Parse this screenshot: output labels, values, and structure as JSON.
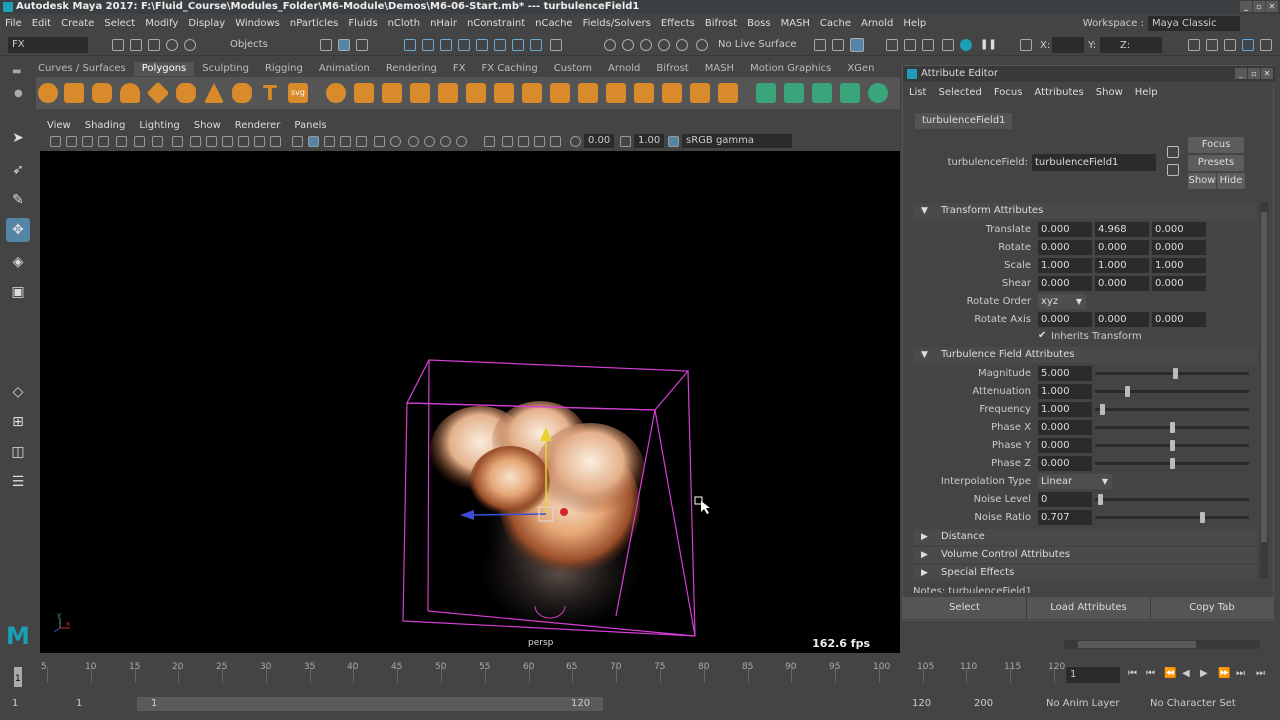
{
  "window": {
    "title": "Autodesk Maya 2017: F:\\Fluid_Course\\Modules_Folder\\M6-Module\\Demos\\M6-06-Start.mb*   ---   turbulenceField1"
  },
  "menubar": {
    "items": [
      "File",
      "Edit",
      "Create",
      "Select",
      "Modify",
      "Display",
      "Windows",
      "nParticles",
      "Fluids",
      "nCloth",
      "nHair",
      "nConstraint",
      "nCache",
      "Fields/Solvers",
      "Effects",
      "Bifrost",
      "Boss",
      "MASH",
      "Cache",
      "Arnold",
      "Help"
    ]
  },
  "workspace": {
    "label": "Workspace :",
    "value": "Maya Classic"
  },
  "statusline": {
    "menuset": "FX",
    "selmode": "Objects",
    "live_surface": "No Live Surface",
    "x_label": "X:",
    "y_label": "Y:",
    "z_label": "Z:"
  },
  "shelf": {
    "tabs": [
      "Curves / Surfaces",
      "Polygons",
      "Sculpting",
      "Rigging",
      "Animation",
      "Rendering",
      "FX",
      "FX Caching",
      "Custom",
      "Arnold",
      "Bifrost",
      "MASH",
      "Motion Graphics",
      "XGen"
    ],
    "active_tab": "Polygons",
    "svg_label": "svg"
  },
  "panel": {
    "menu": [
      "View",
      "Shading",
      "Lighting",
      "Show",
      "Renderer",
      "Panels"
    ],
    "exposure": "0.00",
    "gamma": "1.00",
    "colorspace": "sRGB gamma"
  },
  "viewport": {
    "camera": "persp",
    "fps": "162.6 fps",
    "axis_y": "y",
    "axis_x": "x"
  },
  "attribute_editor": {
    "title": "Attribute Editor",
    "menu": [
      "List",
      "Selected",
      "Focus",
      "Attributes",
      "Show",
      "Help"
    ],
    "tab": "turbulenceField1",
    "node_label": "turbulenceField:",
    "node_value": "turbulenceField1",
    "focus_btn": "Focus",
    "presets_btn": "Presets",
    "show_btn": "Show",
    "hide_btn": "Hide",
    "transform_section": "Transform Attributes",
    "translate": {
      "label": "Translate",
      "x": "0.000",
      "y": "4.968",
      "z": "0.000"
    },
    "rotate": {
      "label": "Rotate",
      "x": "0.000",
      "y": "0.000",
      "z": "0.000"
    },
    "scale": {
      "label": "Scale",
      "x": "1.000",
      "y": "1.000",
      "z": "1.000"
    },
    "shear": {
      "label": "Shear",
      "x": "0.000",
      "y": "0.000",
      "z": "0.000"
    },
    "rotate_order": {
      "label": "Rotate Order",
      "value": "xyz"
    },
    "rotate_axis": {
      "label": "Rotate Axis",
      "x": "0.000",
      "y": "0.000",
      "z": "0.000"
    },
    "inherits_transform": "Inherits Transform",
    "turbulence_section": "Turbulence Field Attributes",
    "fields": [
      {
        "label": "Magnitude",
        "value": "5.000",
        "level": 0.52
      },
      {
        "label": "Attenuation",
        "value": "1.000",
        "level": 0.2
      },
      {
        "label": "Frequency",
        "value": "1.000",
        "level": 0.03
      },
      {
        "label": "Phase X",
        "value": "0.000",
        "level": 0.5
      },
      {
        "label": "Phase Y",
        "value": "0.000",
        "level": 0.5
      },
      {
        "label": "Phase Z",
        "value": "0.000",
        "level": 0.5
      }
    ],
    "interpolation": {
      "label": "Interpolation Type",
      "value": "Linear"
    },
    "noise_level": {
      "label": "Noise Level",
      "value": "0",
      "level": 0.02
    },
    "noise_ratio": {
      "label": "Noise Ratio",
      "value": "0.707",
      "level": 0.7
    },
    "collapsed_sections": [
      "Distance",
      "Volume Control Attributes",
      "Special Effects"
    ],
    "notes": "Notes: turbulenceField1",
    "buttons": {
      "select": "Select",
      "load": "Load Attributes",
      "copy": "Copy Tab"
    }
  },
  "timeslider": {
    "ticks": [
      "5",
      "10",
      "15",
      "20",
      "25",
      "30",
      "35",
      "40",
      "45",
      "50",
      "55",
      "60",
      "65",
      "70",
      "75",
      "80",
      "85",
      "90",
      "95",
      "100",
      "105",
      "110",
      "115",
      "120"
    ],
    "first": "1",
    "current": "1"
  },
  "range": {
    "start": "1",
    "anim_start": "1",
    "range_start": "1",
    "range_end": "120",
    "end": "120",
    "anim_end": "200",
    "anim_layer": "No Anim Layer",
    "char_set": "No Character Set"
  }
}
